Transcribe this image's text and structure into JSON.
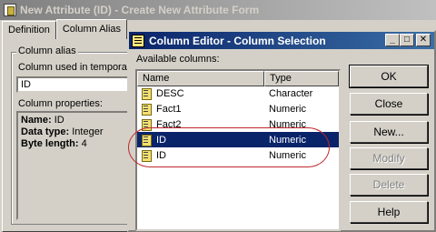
{
  "background_window": {
    "title": "New Attribute (ID) - Create New Attribute Form",
    "tabs": [
      "Definition",
      "Column Alias"
    ],
    "group_title": "Column alias",
    "column_used_label": "Column used in temporary",
    "column_used_value": "ID",
    "column_properties_label": "Column properties:",
    "properties": [
      {
        "key": "Name:",
        "value": "ID"
      },
      {
        "key": "Data type:",
        "value": "Integer"
      },
      {
        "key": "Byte length:",
        "value": "4"
      }
    ]
  },
  "dialog": {
    "title": "Column Editor - Column Selection",
    "title_buttons": [
      "_",
      "□",
      "✕"
    ],
    "available_label": "Available columns:",
    "columns_header": {
      "name": "Name",
      "type": "Type"
    },
    "rows": [
      {
        "name": "DESC",
        "type": "Character",
        "selected": false
      },
      {
        "name": "Fact1",
        "type": "Numeric",
        "selected": false
      },
      {
        "name": "Fact2",
        "type": "Numeric",
        "selected": false
      },
      {
        "name": "ID",
        "type": "Numeric",
        "selected": true
      },
      {
        "name": "ID",
        "type": "Numeric",
        "selected": false
      }
    ],
    "buttons": {
      "ok": "OK",
      "close": "Close",
      "new": "New...",
      "modify": "Modify",
      "delete": "Delete",
      "help": "Help"
    }
  },
  "colors": {
    "annotation": "#c0282e",
    "selection": "#0a246a",
    "active_title": "#0a246a"
  }
}
